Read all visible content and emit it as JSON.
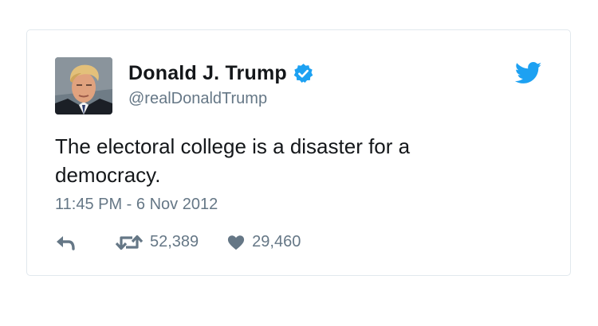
{
  "tweet": {
    "display_name": "Donald J. Trump",
    "handle": "@realDonaldTrump",
    "text": "The electoral college is a disaster for a democracy.",
    "timestamp": "11:45 PM - 6 Nov 2012",
    "retweet_count": "52,389",
    "like_count": "29,460"
  },
  "icons": [
    "verified-badge-icon",
    "twitter-bird-icon",
    "reply-icon",
    "retweet-icon",
    "heart-icon"
  ],
  "colors": {
    "text": "#14171a",
    "muted": "#657786",
    "twitter_blue": "#1da1f2",
    "border": "#e1e8ed"
  }
}
